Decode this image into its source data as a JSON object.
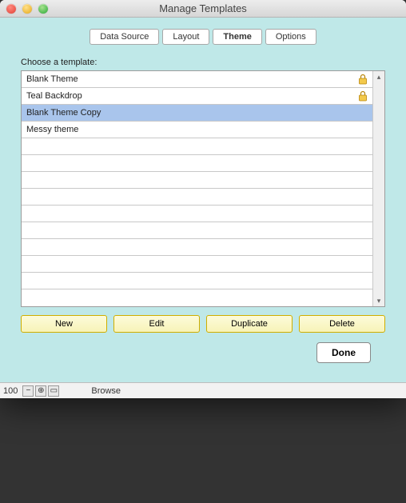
{
  "window": {
    "title": "Manage Templates"
  },
  "tabs": [
    {
      "label": "Data Source",
      "active": false
    },
    {
      "label": "Layout",
      "active": false
    },
    {
      "label": "Theme",
      "active": true
    },
    {
      "label": "Options",
      "active": false
    }
  ],
  "choose_label": "Choose a template:",
  "templates": [
    {
      "name": "Blank Theme",
      "locked": true,
      "selected": false
    },
    {
      "name": "Teal Backdrop",
      "locked": true,
      "selected": false
    },
    {
      "name": "Blank Theme Copy",
      "locked": false,
      "selected": true
    },
    {
      "name": "Messy theme",
      "locked": false,
      "selected": false
    }
  ],
  "empty_rows": 10,
  "actions": {
    "new": "New",
    "edit": "Edit",
    "duplicate": "Duplicate",
    "delete": "Delete"
  },
  "done_label": "Done",
  "status": {
    "zoom": "100",
    "mode": "Browse"
  }
}
